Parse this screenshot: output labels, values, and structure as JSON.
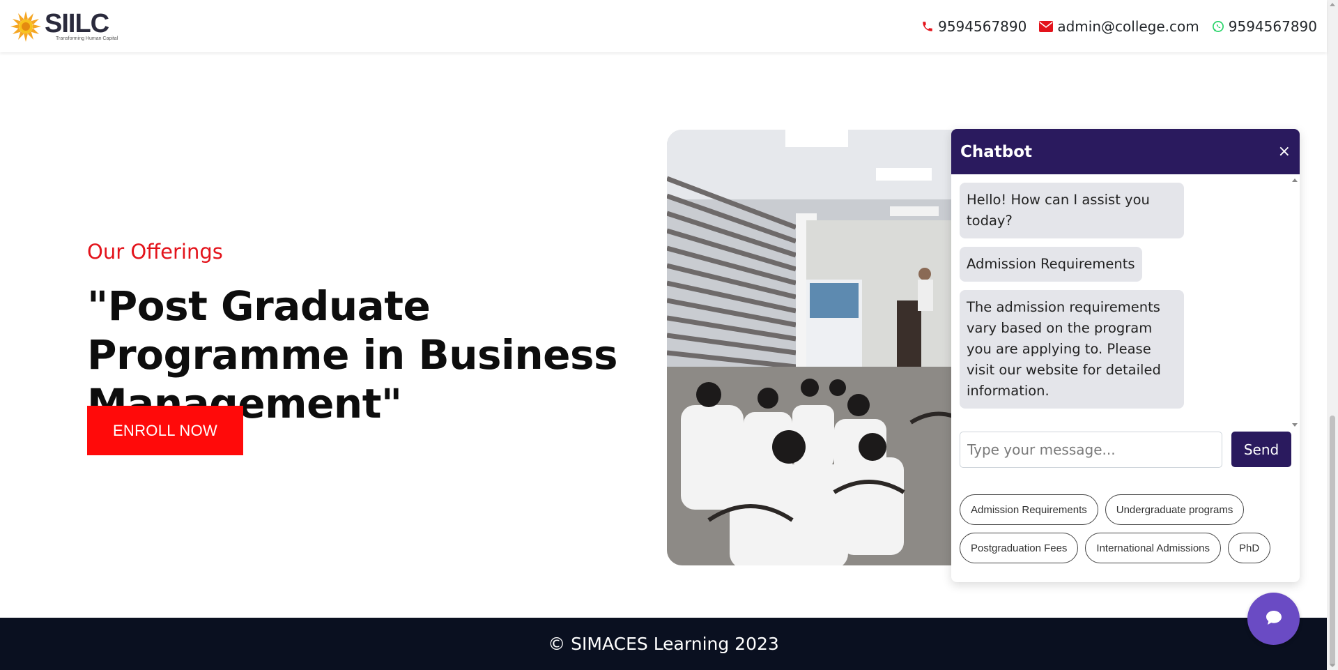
{
  "header": {
    "logo_text": "SIILC",
    "logo_tagline": "Transforming Human Capital",
    "phone": "9594567890",
    "email": "admin@college.com",
    "whatsapp": "9594567890",
    "colors": {
      "phone_icon": "#e3131b",
      "email_icon": "#e3131b",
      "whatsapp_icon": "#25d366",
      "logo_sun": "#f5a623"
    }
  },
  "hero": {
    "label": "Our Offerings",
    "headline": "\"Post Graduate Programme in Business Management\"",
    "enroll_label": "ENROLL NOW",
    "accent_color": "#ff0a0a"
  },
  "chatbot": {
    "title": "Chatbot",
    "close_icon": "×",
    "messages": [
      {
        "text": "Hello! How can I assist you today?"
      },
      {
        "text": "Admission Requirements"
      },
      {
        "text": "The admission requirements vary based on the program you are applying to. Please visit our website for detailed information."
      }
    ],
    "input_placeholder": "Type your message...",
    "send_label": "Send",
    "suggestions": [
      "Admission Requirements",
      "Undergraduate programs",
      "Postgraduation Fees",
      "International Admissions",
      "PhD"
    ],
    "header_color": "#2a1a5e",
    "fab_color": "#6a4bc4",
    "fab_icon": "chat-bubble-icon"
  },
  "footer": {
    "copyright": "© SIMACES Learning 2023"
  }
}
